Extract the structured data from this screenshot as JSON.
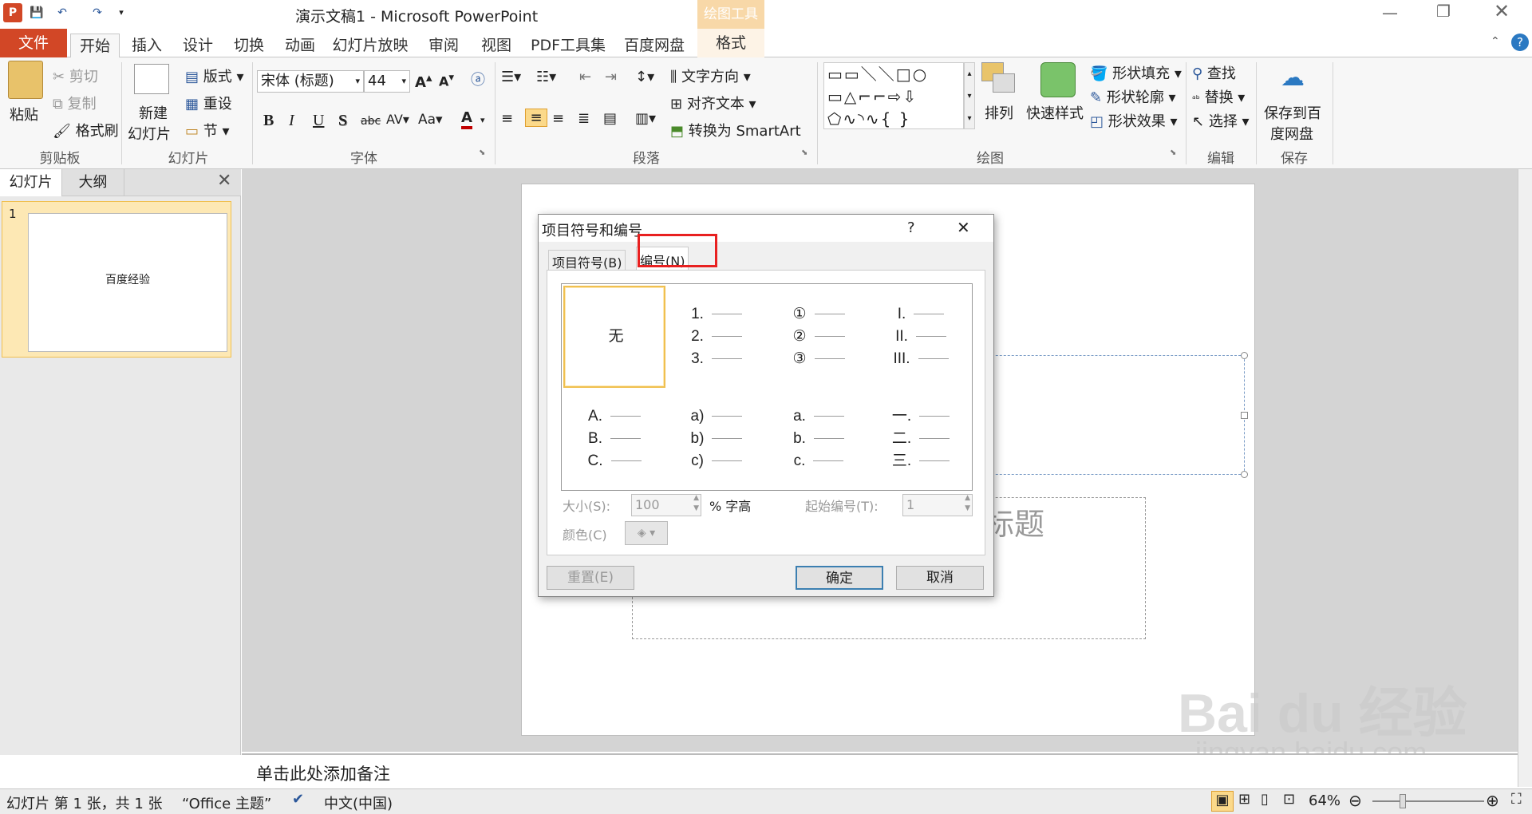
{
  "window": {
    "title": "演示文稿1 - Microsoft PowerPoint",
    "context_tab_group": "绘图工具"
  },
  "tabs": [
    "文件",
    "开始",
    "插入",
    "设计",
    "切换",
    "动画",
    "幻灯片放映",
    "审阅",
    "视图",
    "PDF工具集",
    "百度网盘",
    "格式"
  ],
  "ribbon": {
    "clipboard": {
      "label": "剪贴板",
      "paste": "粘贴",
      "cut": "剪切",
      "copy": "复制",
      "format_painter": "格式刷"
    },
    "slides": {
      "label": "幻灯片",
      "new_slide_1": "新建",
      "new_slide_2": "幻灯片",
      "layout": "版式",
      "reset": "重设",
      "section": "节"
    },
    "font": {
      "label": "字体",
      "font_name": "宋体 (标题)",
      "font_size": "44"
    },
    "paragraph": {
      "label": "段落",
      "text_direction": "文字方向",
      "align_text": "对齐文本",
      "smartart": "转换为 SmartArt"
    },
    "drawing": {
      "label": "绘图",
      "arrange": "排列",
      "quick_styles": "快速样式",
      "shape_fill": "形状填充",
      "shape_outline": "形状轮廓",
      "shape_effects": "形状效果"
    },
    "editing": {
      "label": "编辑",
      "find": "查找",
      "replace": "替换",
      "select": "选择"
    },
    "save": {
      "label": "保存",
      "save_baidu_1": "保存到百",
      "save_baidu_2": "度网盘"
    }
  },
  "left_pane": {
    "tab_slides": "幻灯片",
    "tab_outline": "大纲",
    "slide_number": "1",
    "thumb_text": "百度经验"
  },
  "slide": {
    "subtitle_placeholder_fragment": "标题"
  },
  "notes_placeholder": "单击此处添加备注",
  "status": {
    "slide_info": "幻灯片 第 1 张，共 1 张",
    "theme": "“Office 主题”",
    "language": "中文(中国)",
    "zoom": "64%"
  },
  "dialog": {
    "title": "项目符号和编号",
    "help": "?",
    "close": "✕",
    "tab_bullets": "项目符号(B)",
    "tab_numbering": "编号(N)",
    "none_label": "无",
    "styles": [
      [
        "1.",
        "2.",
        "3."
      ],
      [
        "①",
        "②",
        "③"
      ],
      [
        "I.",
        "II.",
        "III."
      ],
      [
        "A.",
        "B.",
        "C."
      ],
      [
        "a)",
        "b)",
        "c)"
      ],
      [
        "a.",
        "b.",
        "c."
      ],
      [
        "一.",
        "二.",
        "三."
      ]
    ],
    "size_label": "大小(S):",
    "size_value": "100",
    "size_unit": "% 字高",
    "start_label": "起始编号(T):",
    "start_value": "1",
    "color_label": "颜色(C)",
    "reset": "重置(E)",
    "ok": "确定",
    "cancel": "取消"
  },
  "watermark": {
    "text": "Bai du 经验",
    "url": "jingyan.baidu.com"
  }
}
